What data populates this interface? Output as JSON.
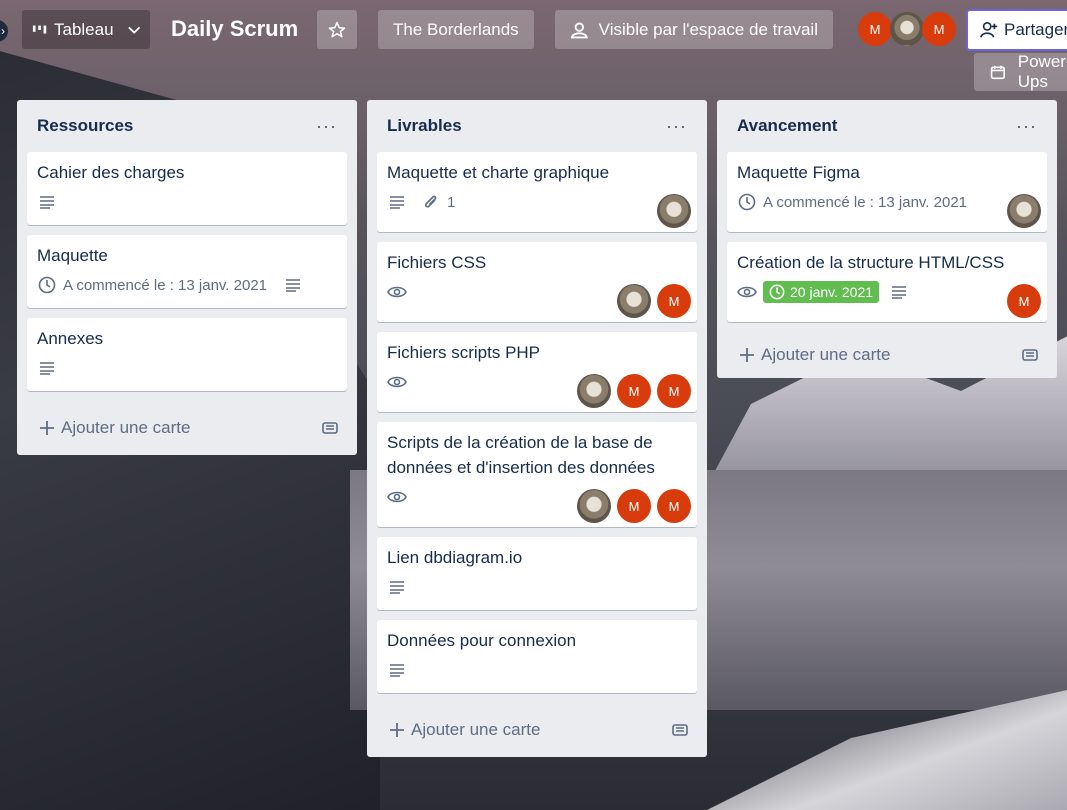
{
  "header": {
    "view_label": "Tableau",
    "board_title": "Daily Scrum",
    "workspace": "The Borderlands",
    "visibility": "Visible par l'espace de travail",
    "share_label": "Partager",
    "power_label": "Power-Ups",
    "member_initial": "M"
  },
  "lists": [
    {
      "title": "Ressources",
      "add_label": "Ajouter une carte",
      "cards": [
        {
          "title": "Cahier des charges"
        },
        {
          "title": "Maquette",
          "start": "A commencé le : 13 janv. 2021"
        },
        {
          "title": "Annexes"
        }
      ]
    },
    {
      "title": "Livrables",
      "add_label": "Ajouter une carte",
      "cards": [
        {
          "title": "Maquette et charte graphique",
          "attachments": "1"
        },
        {
          "title": "Fichiers CSS"
        },
        {
          "title": "Fichiers scripts PHP"
        },
        {
          "title": "Scripts de la création de la base de données et d'insertion des données"
        },
        {
          "title": "Lien dbdiagram.io"
        },
        {
          "title": "Données pour connexion"
        }
      ]
    },
    {
      "title": "Avancement",
      "add_label": "Ajouter une carte",
      "cards": [
        {
          "title": "Maquette Figma",
          "start": "A commencé le : 13 janv. 2021"
        },
        {
          "title": "Création de la structure HTML/CSS",
          "due": "20 janv. 2021"
        }
      ]
    }
  ],
  "colors": {
    "member_red": "#d83b0c",
    "due_green": "#61bd4f",
    "list_bg": "#ebecf0",
    "share_border": "#6c63d9"
  }
}
